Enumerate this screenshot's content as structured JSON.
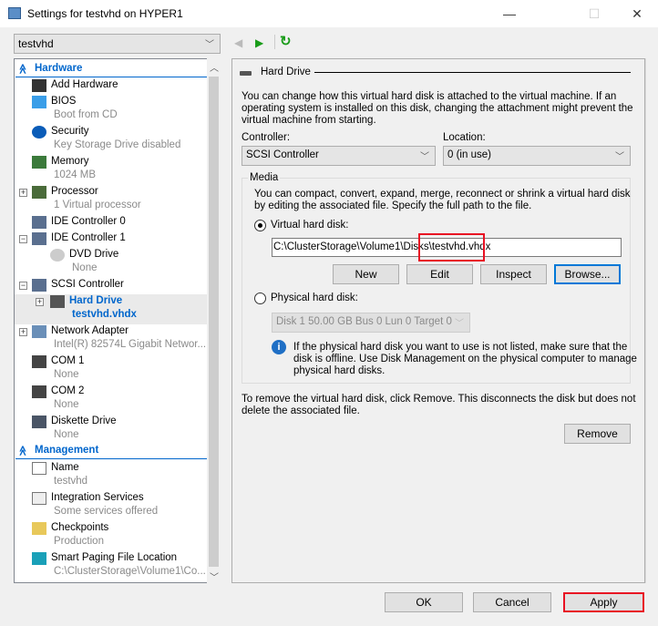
{
  "window": {
    "title": "Settings for testvhd on HYPER1",
    "minimize": "—",
    "maximize": "☐",
    "close": "✕"
  },
  "vm_selector": {
    "value": "testvhd"
  },
  "tree": {
    "hardware_label": "Hardware",
    "management_label": "Management",
    "items": [
      {
        "label": "Add Hardware",
        "icon": "add-hardware-icon"
      },
      {
        "label": "BIOS",
        "sub": "Boot from CD",
        "icon": "bios-icon"
      },
      {
        "label": "Security",
        "sub": "Key Storage Drive disabled",
        "icon": "shield-icon"
      },
      {
        "label": "Memory",
        "sub": "1024 MB",
        "icon": "memory-icon"
      },
      {
        "label": "Processor",
        "sub": "1 Virtual processor",
        "icon": "processor-icon",
        "expander": "+"
      },
      {
        "label": "IDE Controller 0",
        "icon": "ide-controller-icon"
      },
      {
        "label": "IDE Controller 1",
        "icon": "ide-controller-icon",
        "expander": "−"
      },
      {
        "label": "DVD Drive",
        "sub": "None",
        "icon": "dvd-icon",
        "level": 1
      },
      {
        "label": "SCSI Controller",
        "icon": "scsi-controller-icon",
        "expander": "−"
      },
      {
        "label": "Hard Drive",
        "sub": "testvhd.vhdx",
        "icon": "hard-drive-icon",
        "level": 1,
        "expander": "+",
        "selected": true
      },
      {
        "label": "Network Adapter",
        "sub": "Intel(R) 82574L Gigabit Networ...",
        "icon": "network-adapter-icon",
        "expander": "+"
      },
      {
        "label": "COM 1",
        "sub": "None",
        "icon": "com-port-icon"
      },
      {
        "label": "COM 2",
        "sub": "None",
        "icon": "com-port-icon"
      },
      {
        "label": "Diskette Drive",
        "sub": "None",
        "icon": "diskette-icon"
      }
    ],
    "management_items": [
      {
        "label": "Name",
        "sub": "testvhd",
        "icon": "name-icon"
      },
      {
        "label": "Integration Services",
        "sub": "Some services offered",
        "icon": "integration-services-icon"
      },
      {
        "label": "Checkpoints",
        "sub": "Production",
        "icon": "checkpoints-icon"
      },
      {
        "label": "Smart Paging File Location",
        "sub": "C:\\ClusterStorage\\Volume1\\Co...",
        "icon": "smart-paging-icon"
      }
    ]
  },
  "panel": {
    "title": "Hard Drive",
    "description": [
      "You can change how this virtual hard disk is attached to the virtual machine. If an",
      "operating system is installed on this disk, changing the attachment might prevent the",
      "virtual machine from starting."
    ],
    "controller_label": "Controller:",
    "controller_value": "SCSI Controller",
    "location_label": "Location:",
    "location_value": "0 (in use)",
    "media_label": "Media",
    "media_text": [
      "You can compact, convert, expand, merge, reconnect or shrink a virtual hard disk",
      "by editing the associated file. Specify the full path to the file."
    ],
    "vhd_radio_label": "Virtual hard disk:",
    "vhd_selected": true,
    "vhd_path": "C:\\ClusterStorage\\Volume1\\Disks\\testvhd.vhdx",
    "new_label": "New",
    "edit_label": "Edit",
    "inspect_label": "Inspect",
    "browse_label": "Browse...",
    "physical_radio_label": "Physical hard disk:",
    "physical_value": "Disk 1 50.00 GB Bus 0 Lun 0 Target 0",
    "info_text": [
      "If the physical hard disk you want to use is not listed, make sure that the",
      "disk is offline. Use Disk Management on the physical computer to manage",
      "physical hard disks."
    ],
    "remove_text": [
      "To remove the virtual hard disk, click Remove. This disconnects the disk but does not",
      "delete the associated file."
    ],
    "remove_label": "Remove"
  },
  "footer": {
    "ok_label": "OK",
    "cancel_label": "Cancel",
    "apply_label": "Apply"
  },
  "colors": {
    "accent": "#0066cc",
    "highlight": "#e81123",
    "green": "#1a9c1a"
  }
}
